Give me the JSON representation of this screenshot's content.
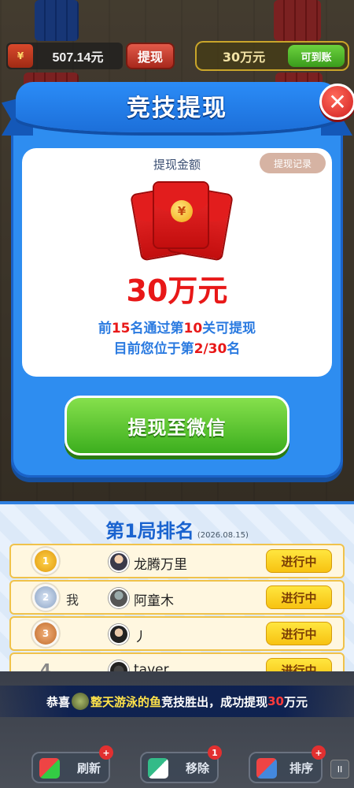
{
  "hud": {
    "balance": "507.14元",
    "withdraw_label": "提现",
    "goal_amount": "30万元",
    "goal_button": "可到账"
  },
  "modal": {
    "title": "竞技提现",
    "close_glyph": "✕",
    "amount_label": "提现金额",
    "records_label": "提现记录",
    "yuan_glyph": "¥",
    "amount": "30万元",
    "rule_prefix": "前",
    "rule_rank": "15",
    "rule_mid": "名通过第",
    "rule_level": "10",
    "rule_suffix": "关可提现",
    "pos_prefix": "目前您位于第",
    "pos_value": "2/30",
    "pos_suffix": "名",
    "wechat_button": "提现至微信"
  },
  "ranking": {
    "title": "第1局排名",
    "date": "(2026.08.15)",
    "rows": [
      {
        "rank": "1",
        "me": "",
        "name": "龙腾万里",
        "status": "进行中"
      },
      {
        "rank": "2",
        "me": "我",
        "name": "阿童木",
        "status": "进行中"
      },
      {
        "rank": "3",
        "me": "",
        "name": "丿",
        "status": "进行中"
      },
      {
        "rank": "4",
        "me": "",
        "name": "taver",
        "status": "进行中"
      }
    ]
  },
  "ticker": {
    "prefix": "恭喜",
    "player": "整天游泳的鱼",
    "mid": "竞技胜出，成功提现",
    "amount": "30",
    "suffix": "万元"
  },
  "tools": [
    {
      "label": "刷新",
      "badge": "+",
      "icon": "refresh-icon"
    },
    {
      "label": "移除",
      "badge": "1",
      "icon": "remove-icon"
    },
    {
      "label": "排序",
      "badge": "+",
      "icon": "sort-icon"
    }
  ],
  "pause_glyph": "II",
  "colors": {
    "modal_blue": "#2e8df0",
    "accent_red": "#e81818",
    "text_blue": "#2a7ae0",
    "green_button": "#3cae1e",
    "status_yellow": "#f7c211"
  }
}
